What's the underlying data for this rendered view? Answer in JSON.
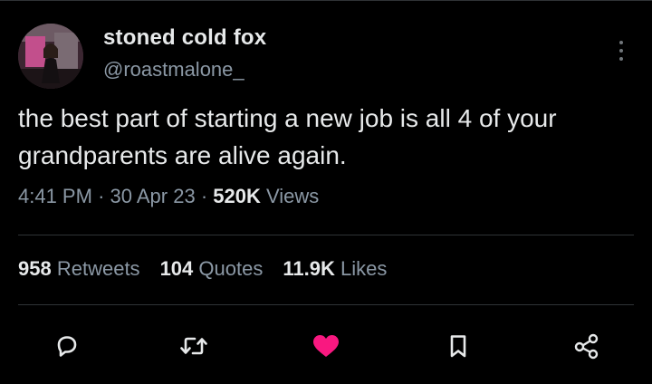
{
  "user": {
    "display_name": "stoned cold fox",
    "handle": "@roastmalone_"
  },
  "tweet": {
    "text": "the best part of starting a new job is all 4 of your grandparents are alive again.",
    "time": "4:41 PM",
    "separator": "·",
    "date": "30 Apr 23",
    "views_count": "520K",
    "views_label": "Views"
  },
  "stats": {
    "retweets_count": "958",
    "retweets_label": "Retweets",
    "quotes_count": "104",
    "quotes_label": "Quotes",
    "likes_count": "11.9K",
    "likes_label": "Likes"
  },
  "actions": {
    "reply_icon": "reply-icon",
    "retweet_icon": "retweet-icon",
    "like_icon": "heart-icon",
    "bookmark_icon": "bookmark-icon",
    "share_icon": "share-icon"
  },
  "colors": {
    "background": "#000000",
    "text": "#e7e9ea",
    "secondary": "#8b98a5",
    "like_active": "#f91880",
    "divider": "#2f3336"
  }
}
